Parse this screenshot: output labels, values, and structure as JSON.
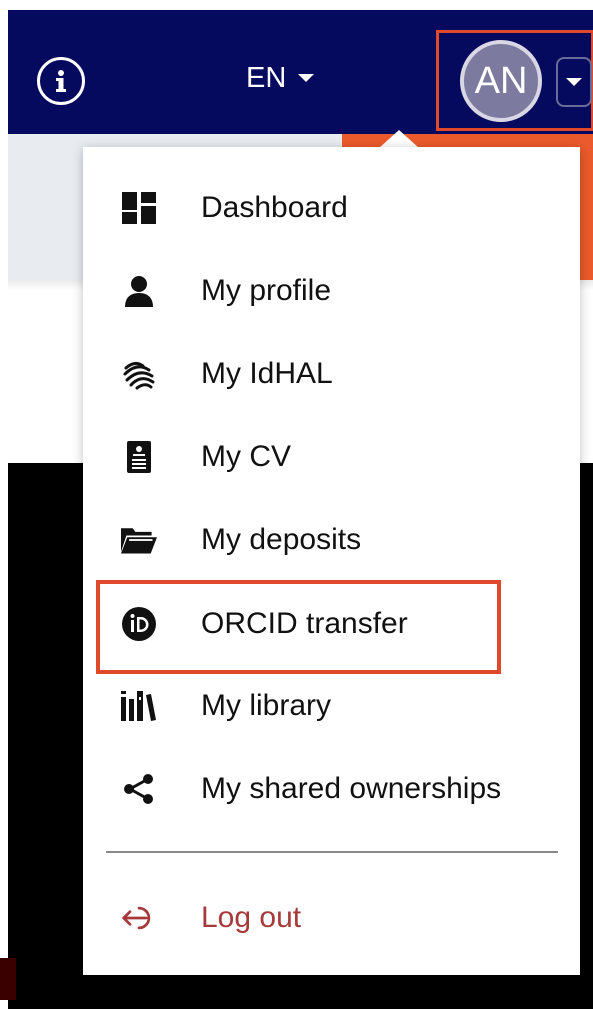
{
  "header": {
    "language": "EN",
    "avatar_initials": "AN"
  },
  "menu": {
    "items": [
      {
        "label": "Dashboard",
        "icon": "dashboard-icon"
      },
      {
        "label": "My profile",
        "icon": "user-icon"
      },
      {
        "label": "My IdHAL",
        "icon": "idhal-icon"
      },
      {
        "label": "My CV",
        "icon": "cv-icon"
      },
      {
        "label": "My deposits",
        "icon": "folder-open-icon"
      },
      {
        "label": "ORCID transfer",
        "icon": "orcid-icon"
      },
      {
        "label": "My library",
        "icon": "library-icon"
      },
      {
        "label": "My shared ownerships",
        "icon": "share-icon"
      }
    ],
    "logout_label": "Log out"
  },
  "colors": {
    "header_bg": "#060a5e",
    "highlight": "#e0492a",
    "logout": "#a63a3a"
  }
}
